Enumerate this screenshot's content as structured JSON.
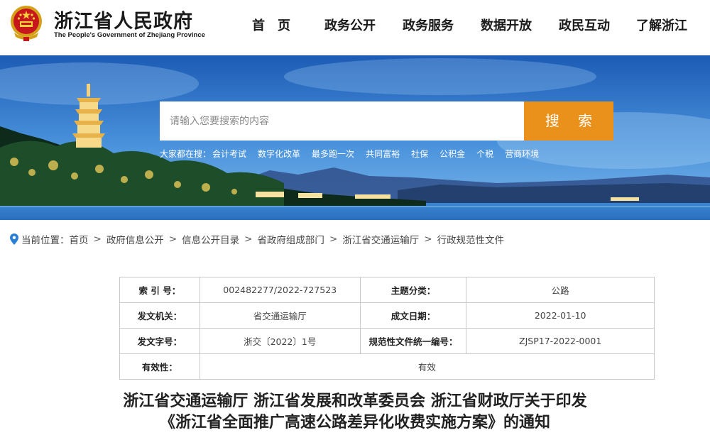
{
  "header": {
    "site_name_cn": "浙江省人民政府",
    "site_name_en": "The People's Government of Zhejiang Province",
    "emblem_icon": "national-emblem-icon",
    "nav": [
      {
        "label": "首　页"
      },
      {
        "label": "政务公开"
      },
      {
        "label": "政务服务"
      },
      {
        "label": "数据开放"
      },
      {
        "label": "政民互动"
      },
      {
        "label": "了解浙江"
      }
    ]
  },
  "search": {
    "placeholder": "请输入您要搜索的内容",
    "button_label": "搜 索",
    "hot_prefix": "大家都在搜：",
    "hot_terms": [
      "会计考试",
      "数字化改革",
      "最多跑一次",
      "共同富裕",
      "社保",
      "公积金",
      "个税",
      "营商环境"
    ]
  },
  "breadcrumb": {
    "prefix": "当前位置：",
    "items": [
      "首页",
      "政府信息公开",
      "信息公开目录",
      "省政府组成部门",
      "浙江省交通运输厅",
      "行政规范性文件"
    ],
    "separator": ">"
  },
  "info_table": {
    "index_label": "索 引 号：",
    "index_value": "002482277/2022-727523",
    "category_label": "主题分类：",
    "category_value": "公路",
    "issuer_label": "发文机关：",
    "issuer_value": "省交通运输厅",
    "date_label": "成文日期：",
    "date_value": "2022-01-10",
    "doc_no_label": "发文字号：",
    "doc_no_value": "浙交〔2022〕1号",
    "unified_no_label": "规范性文件统一编号：",
    "unified_no_value": "ZJSP17-2022-0001",
    "validity_label": "有效性：",
    "validity_value": "有效"
  },
  "article": {
    "title_line1": "浙江省交通运输厅 浙江省发展和改革委员会 浙江省财政厅关于印发",
    "title_line2": "《浙江省全面推广高速公路差异化收费实施方案》的通知"
  },
  "colors": {
    "accent": "#e9911b",
    "pin": "#2a7fd4",
    "sky_top": "#1f5fb8",
    "water": "#2a78c9"
  }
}
